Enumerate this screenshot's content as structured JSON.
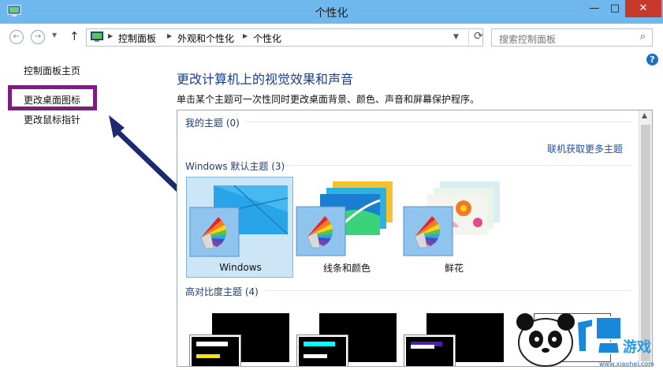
{
  "window": {
    "title": "个性化",
    "min_label": "—",
    "max_label": "□",
    "close_label": "✕"
  },
  "navbar": {
    "back_label": "←",
    "forward_label": "→",
    "up_label": "↑",
    "breadcrumbs": [
      "控制面板",
      "外观和个性化",
      "个性化"
    ],
    "search_placeholder": "搜索控制面板"
  },
  "left_pane": {
    "items": [
      {
        "label": "控制面板主页"
      },
      {
        "label": "更改桌面图标"
      },
      {
        "label": "更改鼠标指针"
      }
    ]
  },
  "content": {
    "title": "更改计算机上的视觉效果和声音",
    "description": "单击某个主题可一次性同时更改桌面背景、颜色、声音和屏幕保护程序。",
    "my_themes": "我的主题 (0)",
    "online_link": "联机获取更多主题",
    "default_section": "Windows 默认主题 (3)",
    "default_themes": [
      {
        "name": "Windows",
        "selected": true
      },
      {
        "name": "线条和颜色",
        "selected": false
      },
      {
        "name": "鲜花",
        "selected": false
      }
    ],
    "high_contrast_section": "高对比度主题 (4)",
    "high_contrast_colors": [
      "#ffffff",
      "#00ffff",
      "#ffffff",
      "#ffffff"
    ]
  },
  "watermark": {
    "brand": "小黑游戏",
    "url": "www.xiaohei.com"
  },
  "colors": {
    "titlebar": "#6fb8ee",
    "accent_link": "#1a4fa8",
    "highlight_box": "#7a1f7d",
    "arrow": "#1e2a6e",
    "close_button": "#c7392b"
  }
}
